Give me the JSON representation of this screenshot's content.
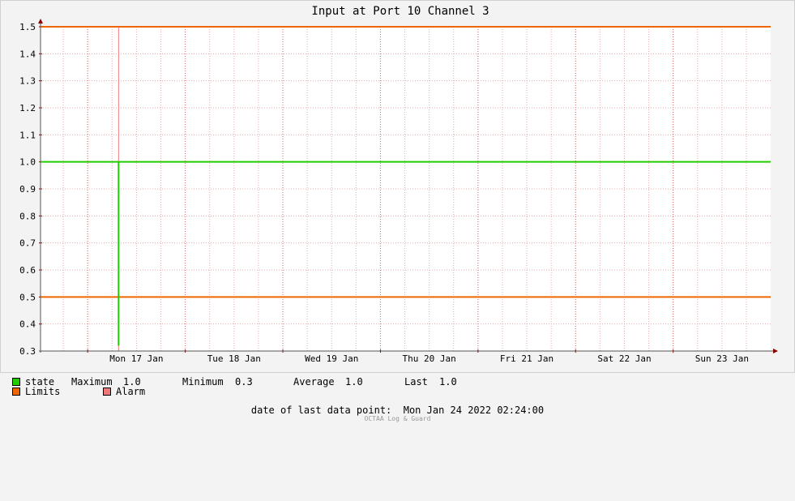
{
  "colors": {
    "background": "#f3f3f3",
    "plot_background": "#ffffff",
    "state": "#22cc00",
    "limits": "#ee6600",
    "alarm": "#ee7777",
    "grid": "#e8aaaa",
    "axis": "#999999",
    "arrow": "#880000"
  },
  "chart_data": {
    "type": "line",
    "title": "Input at Port 10 Channel 3",
    "ylim": [
      0.3,
      1.5
    ],
    "yticks": [
      "0.3",
      "0.4",
      "0.5",
      "0.6",
      "0.7",
      "0.8",
      "0.9",
      "1.0",
      "1.1",
      "1.2",
      "1.3",
      "1.4",
      "1.5"
    ],
    "xlim": [
      "2022-01-16T12:24",
      "2022-01-23T23:59"
    ],
    "xticks": [
      {
        "label": "Mon 17 Jan",
        "t": "2022-01-17T12:00"
      },
      {
        "label": "Tue 18 Jan",
        "t": "2022-01-18T12:00"
      },
      {
        "label": "Wed 19 Jan",
        "t": "2022-01-19T12:00"
      },
      {
        "label": "Thu 20 Jan",
        "t": "2022-01-20T12:00"
      },
      {
        "label": "Fri 21 Jan",
        "t": "2022-01-21T12:00"
      },
      {
        "label": "Sat 22 Jan",
        "t": "2022-01-22T12:00"
      },
      {
        "label": "Sun 23 Jan",
        "t": "2022-01-23T12:00"
      }
    ],
    "grid": true,
    "series": [
      {
        "name": "state",
        "x": [
          "2022-01-17T07:36",
          "2022-01-17T07:36",
          "2022-01-23T23:59"
        ],
        "y": [
          0.32,
          1.0,
          1.0
        ]
      }
    ],
    "limits": {
      "name": "Limits",
      "values": [
        0.5,
        1.5
      ]
    },
    "alarm": {
      "name": "Alarm",
      "t": "2022-01-17T07:36"
    },
    "stats": {
      "maximum_label": "Maximum",
      "maximum": "1.0",
      "minimum_label": "Minimum",
      "minimum": "0.3",
      "average_label": "Average",
      "average": "1.0",
      "last_label": "Last",
      "last": "1.0"
    }
  },
  "footer": {
    "date_label": "date of last data point:",
    "date_value": "Mon Jan 24 2022 02:24:00",
    "watermark": "OCTAA Log & Guard"
  }
}
